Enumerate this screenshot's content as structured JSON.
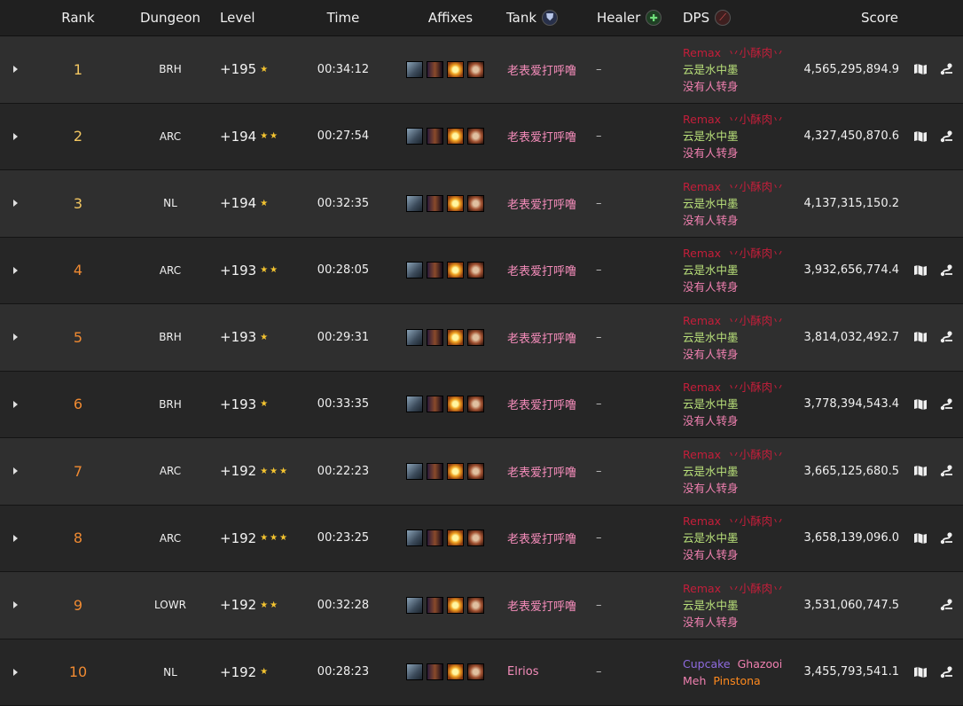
{
  "headers": {
    "rank": "Rank",
    "dungeon": "Dungeon",
    "level": "Level",
    "time": "Time",
    "affixes": "Affixes",
    "tank": "Tank",
    "healer": "Healer",
    "dps": "DPS",
    "score": "Score"
  },
  "icons": {
    "tank": "shield-icon",
    "healer": "plus-icon",
    "dps": "sword-icon",
    "expand": "caret-right-icon",
    "map": "map-icon",
    "route": "route-icon"
  },
  "rows": [
    {
      "rank": "1",
      "dungeon": "BRH",
      "level": "+195",
      "stars": "★",
      "time": "00:34:12",
      "tank": "老表爱打呼噜",
      "healer": "–",
      "dps": [
        "Remax",
        "丷小酥肉丷",
        "云是水中墨",
        "没有人转身"
      ],
      "score": "4,565,295,894.9",
      "has_map": true,
      "has_route": true
    },
    {
      "rank": "2",
      "dungeon": "ARC",
      "level": "+194",
      "stars": "★★",
      "time": "00:27:54",
      "tank": "老表爱打呼噜",
      "healer": "–",
      "dps": [
        "Remax",
        "丷小酥肉丷",
        "云是水中墨",
        "没有人转身"
      ],
      "score": "4,327,450,870.6",
      "has_map": true,
      "has_route": true
    },
    {
      "rank": "3",
      "dungeon": "NL",
      "level": "+194",
      "stars": "★",
      "time": "00:32:35",
      "tank": "老表爱打呼噜",
      "healer": "–",
      "dps": [
        "Remax",
        "丷小酥肉丷",
        "云是水中墨",
        "没有人转身"
      ],
      "score": "4,137,315,150.2",
      "has_map": false,
      "has_route": false
    },
    {
      "rank": "4",
      "dungeon": "ARC",
      "level": "+193",
      "stars": "★★",
      "time": "00:28:05",
      "tank": "老表爱打呼噜",
      "healer": "–",
      "dps": [
        "Remax",
        "丷小酥肉丷",
        "云是水中墨",
        "没有人转身"
      ],
      "score": "3,932,656,774.4",
      "has_map": true,
      "has_route": true
    },
    {
      "rank": "5",
      "dungeon": "BRH",
      "level": "+193",
      "stars": "★",
      "time": "00:29:31",
      "tank": "老表爱打呼噜",
      "healer": "–",
      "dps": [
        "Remax",
        "丷小酥肉丷",
        "云是水中墨",
        "没有人转身"
      ],
      "score": "3,814,032,492.7",
      "has_map": true,
      "has_route": true
    },
    {
      "rank": "6",
      "dungeon": "BRH",
      "level": "+193",
      "stars": "★",
      "time": "00:33:35",
      "tank": "老表爱打呼噜",
      "healer": "–",
      "dps": [
        "Remax",
        "丷小酥肉丷",
        "云是水中墨",
        "没有人转身"
      ],
      "score": "3,778,394,543.4",
      "has_map": true,
      "has_route": true
    },
    {
      "rank": "7",
      "dungeon": "ARC",
      "level": "+192",
      "stars": "★★★",
      "time": "00:22:23",
      "tank": "老表爱打呼噜",
      "healer": "–",
      "dps": [
        "Remax",
        "丷小酥肉丷",
        "云是水中墨",
        "没有人转身"
      ],
      "score": "3,665,125,680.5",
      "has_map": true,
      "has_route": true
    },
    {
      "rank": "8",
      "dungeon": "ARC",
      "level": "+192",
      "stars": "★★★",
      "time": "00:23:25",
      "tank": "老表爱打呼噜",
      "healer": "–",
      "dps": [
        "Remax",
        "丷小酥肉丷",
        "云是水中墨",
        "没有人转身"
      ],
      "score": "3,658,139,096.0",
      "has_map": true,
      "has_route": true
    },
    {
      "rank": "9",
      "dungeon": "LOWR",
      "level": "+192",
      "stars": "★★",
      "time": "00:32:28",
      "tank": "老表爱打呼噜",
      "healer": "–",
      "dps": [
        "Remax",
        "丷小酥肉丷",
        "云是水中墨",
        "没有人转身"
      ],
      "score": "3,531,060,747.5",
      "has_map": false,
      "has_route": true
    },
    {
      "rank": "10",
      "dungeon": "NL",
      "level": "+192",
      "stars": "★",
      "time": "00:28:23",
      "tank": "Elrios",
      "healer": "–",
      "dps": [
        "Cupcake",
        "Ghazooi",
        "Meh",
        "Pinstona"
      ],
      "score": "3,455,793,541.1",
      "has_map": true,
      "has_route": true
    }
  ]
}
